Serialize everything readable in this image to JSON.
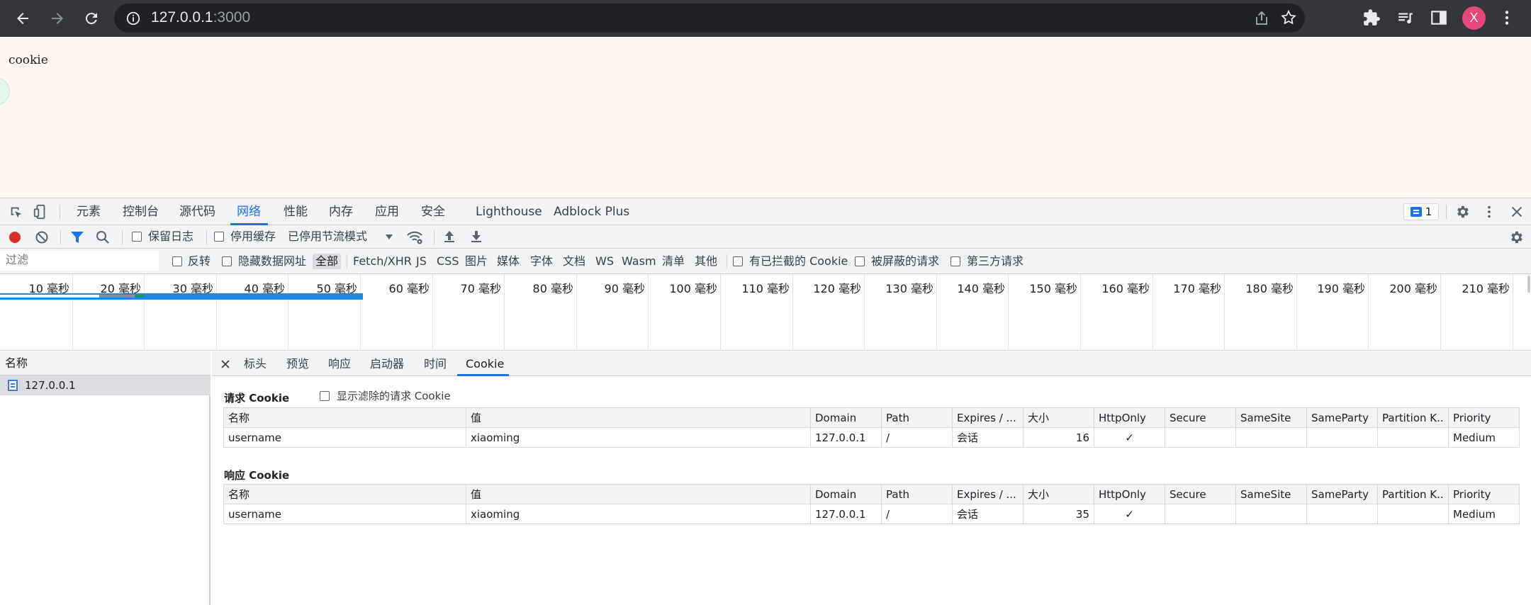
{
  "browser": {
    "url_host": "127.0.0.1",
    "url_port": ":3000",
    "avatar_letter": "X"
  },
  "page": {
    "text": "cookie"
  },
  "devtools": {
    "tabs": [
      "元素",
      "控制台",
      "源代码",
      "网络",
      "性能",
      "内存",
      "应用",
      "安全",
      "Lighthouse",
      "Adblock Plus"
    ],
    "active_tab": "网络",
    "issues_count": "1",
    "toolbar": {
      "preserve_log": "保留日志",
      "disable_cache": "停用缓存",
      "throttle": "已停用节流模式"
    },
    "filter": {
      "placeholder": "过滤",
      "invert": "反转",
      "hide_data_urls": "隐藏数据网址",
      "types": [
        "全部",
        "Fetch/XHR",
        "JS",
        "CSS",
        "图片",
        "媒体",
        "字体",
        "文档",
        "WS",
        "Wasm",
        "清单",
        "其他"
      ],
      "blocked_cookies": "有已拦截的 Cookie",
      "blocked_requests": "被屏蔽的请求",
      "third_party": "第三方请求"
    },
    "overview_ticks": [
      "10 毫秒",
      "20 毫秒",
      "30 毫秒",
      "40 毫秒",
      "50 毫秒",
      "60 毫秒",
      "70 毫秒",
      "80 毫秒",
      "90 毫秒",
      "100 毫秒",
      "110 毫秒",
      "120 毫秒",
      "130 毫秒",
      "140 毫秒",
      "150 毫秒",
      "160 毫秒",
      "170 毫秒",
      "180 毫秒",
      "190 毫秒",
      "200 毫秒",
      "210 毫秒"
    ],
    "name_column": "名称",
    "request_name": "127.0.0.1",
    "detail_tabs": [
      "标头",
      "预览",
      "响应",
      "启动器",
      "时间",
      "Cookie"
    ],
    "active_detail_tab": "Cookie",
    "show_filtered": "显示滤除的请求 Cookie",
    "request_cookie_title": "请求 Cookie",
    "response_cookie_title": "响应 Cookie",
    "columns": [
      "名称",
      "值",
      "Domain",
      "Path",
      "Expires / ...",
      "大小",
      "HttpOnly",
      "Secure",
      "SameSite",
      "SameParty",
      "Partition K..",
      "Priority"
    ],
    "request_cookies": [
      {
        "name": "username",
        "value": "xiaoming",
        "domain": "127.0.0.1",
        "path": "/",
        "expires": "会话",
        "size": "16",
        "httponly": "✓",
        "secure": "",
        "samesite": "",
        "sameparty": "",
        "partition": "",
        "priority": "Medium"
      }
    ],
    "response_cookies": [
      {
        "name": "username",
        "value": "xiaoming",
        "domain": "127.0.0.1",
        "path": "/",
        "expires": "会话",
        "size": "35",
        "httponly": "✓",
        "secure": "",
        "samesite": "",
        "sameparty": "",
        "partition": "",
        "priority": "Medium"
      }
    ]
  }
}
